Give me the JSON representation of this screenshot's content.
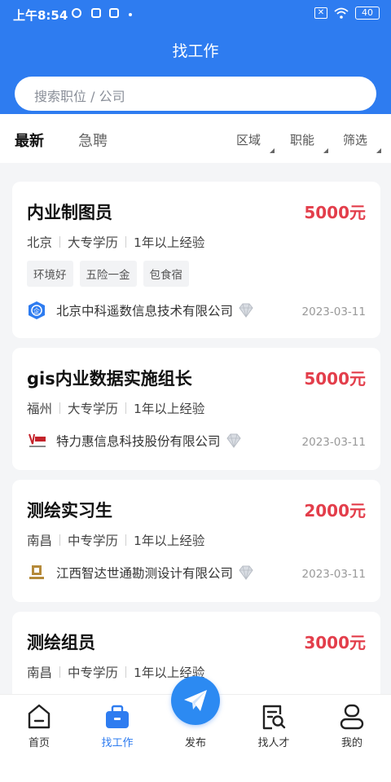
{
  "status_bar": {
    "time": "上午8:54",
    "battery": "40"
  },
  "header": {
    "title": "找工作"
  },
  "search": {
    "placeholder": "搜索职位 / 公司"
  },
  "filter_bar": {
    "tabs": [
      {
        "label": "最新",
        "active": true
      },
      {
        "label": "急聘",
        "active": false
      }
    ],
    "filters": [
      {
        "label": "区域"
      },
      {
        "label": "职能"
      },
      {
        "label": "筛选"
      }
    ]
  },
  "jobs": [
    {
      "title": "内业制图员",
      "salary": "5000元",
      "city": "北京",
      "education": "大专学历",
      "experience": "1年以上经验",
      "tags": [
        "环境好",
        "五险一金",
        "包食宿"
      ],
      "company": "北京中科遥数信息技术有限公司",
      "logo": "enterprise-icon",
      "date": "2023-03-11"
    },
    {
      "title": "gis内业数据实施组长",
      "salary": "5000元",
      "city": "福州",
      "education": "大专学历",
      "experience": "1年以上经验",
      "tags": [],
      "company": "特力惠信息科技股份有限公司",
      "logo": "company-logo",
      "date": "2023-03-11"
    },
    {
      "title": "测绘实习生",
      "salary": "2000元",
      "city": "南昌",
      "education": "中专学历",
      "experience": "1年以上经验",
      "tags": [],
      "company": "江西智达世通勘测设计有限公司",
      "logo": "company-logo",
      "date": "2023-03-11"
    },
    {
      "title": "测绘组员",
      "salary": "3000元",
      "city": "南昌",
      "education": "中专学历",
      "experience": "1年以上经验",
      "tags": [],
      "company": "",
      "logo": "",
      "date": ""
    }
  ],
  "bottom_nav": [
    {
      "label": "首页",
      "icon": "home-icon",
      "active": false
    },
    {
      "label": "找工作",
      "icon": "briefcase-icon",
      "active": true
    },
    {
      "label": "发布",
      "icon": "paper-plane-icon",
      "active": false
    },
    {
      "label": "找人才",
      "icon": "search-document-icon",
      "active": false
    },
    {
      "label": "我的",
      "icon": "user-icon",
      "active": false
    }
  ],
  "colors": {
    "primary": "#2e7cf0",
    "salary": "#e33e4b"
  }
}
